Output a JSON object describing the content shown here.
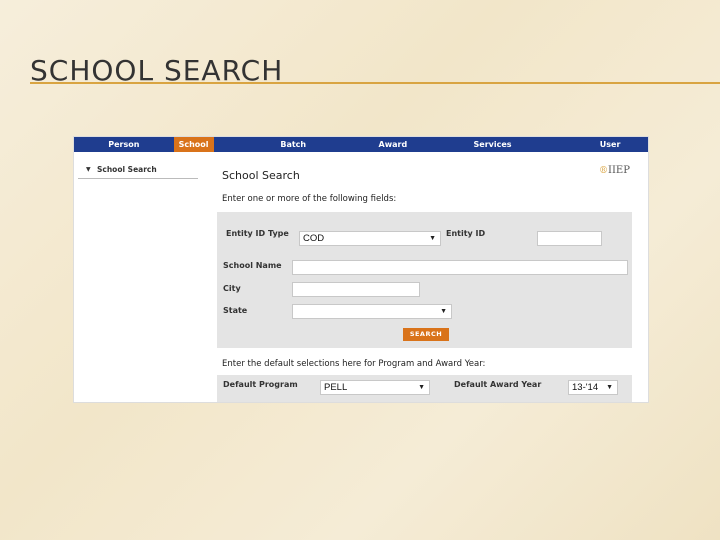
{
  "slide": {
    "title": "SCHOOL SEARCH"
  },
  "nav": {
    "items": [
      "Person",
      "School",
      "Batch",
      "Award",
      "Services",
      "User"
    ],
    "active": "School"
  },
  "sidebar": {
    "item_label": "School Search"
  },
  "page": {
    "title": "School Search",
    "logo": "IIEP",
    "instruction": "Enter one or more of the following fields:",
    "search_button": "SEARCH",
    "defaults_instruction": "Enter the default selections here for Program and Award Year:"
  },
  "form": {
    "entity_id_type_label": "Entity ID Type",
    "entity_id_type_value": "COD",
    "entity_id_label": "Entity ID",
    "entity_id_value": "",
    "school_name_label": "School Name",
    "school_name_value": "",
    "city_label": "City",
    "city_value": "",
    "state_label": "State",
    "state_value": ""
  },
  "defaults": {
    "program_label": "Default Program",
    "program_value": "PELL",
    "award_year_label": "Default Award Year",
    "award_year_value": "13-'14"
  },
  "colors": {
    "nav_bg": "#1f3d8f",
    "nav_active": "#d9731a",
    "button_bg": "#d9731a",
    "rule": "#d9a441"
  }
}
